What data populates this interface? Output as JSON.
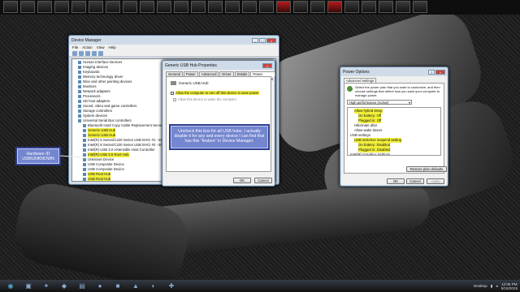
{
  "device_manager": {
    "title": "Device Manager",
    "menu": [
      "File",
      "Action",
      "View",
      "Help"
    ],
    "tree": [
      {
        "label": "Human Interface Devices",
        "hl": false,
        "indent": 1
      },
      {
        "label": "Imaging devices",
        "hl": false,
        "indent": 1
      },
      {
        "label": "Keyboards",
        "hl": false,
        "indent": 1
      },
      {
        "label": "Memory technology driver",
        "hl": false,
        "indent": 1
      },
      {
        "label": "Mice and other pointing devices",
        "hl": false,
        "indent": 1
      },
      {
        "label": "Monitors",
        "hl": false,
        "indent": 1
      },
      {
        "label": "Network adapters",
        "hl": false,
        "indent": 1
      },
      {
        "label": "Processors",
        "hl": false,
        "indent": 1
      },
      {
        "label": "SD host adapters",
        "hl": false,
        "indent": 1
      },
      {
        "label": "Sound, video and game controllers",
        "hl": false,
        "indent": 1
      },
      {
        "label": "Storage controllers",
        "hl": false,
        "indent": 1
      },
      {
        "label": "System devices",
        "hl": false,
        "indent": 1
      },
      {
        "label": "Universal Serial Bus controllers",
        "hl": false,
        "indent": 1
      },
      {
        "label": "Bluetooth Hard Copy Cable Replacement Server",
        "hl": false,
        "indent": 2
      },
      {
        "label": "Generic USB Hub",
        "hl": true,
        "indent": 2
      },
      {
        "label": "Generic USB Hub",
        "hl": true,
        "indent": 2
      },
      {
        "label": "Intel(R) 8 Series/C220 Series USB EHCI #1 - 8C26",
        "hl": false,
        "indent": 2
      },
      {
        "label": "Intel(R) 8 Series/C220 Series USB EHCI #2 - 8C2D",
        "hl": false,
        "indent": 2
      },
      {
        "label": "Intel(R) USB 3.0 eXtensible Host Controller",
        "hl": false,
        "indent": 2
      },
      {
        "label": "Intel(R) USB 3.0 Root Hub",
        "hl": true,
        "indent": 2
      },
      {
        "label": "Unknown Device",
        "hl": false,
        "indent": 2
      },
      {
        "label": "USB Composite Device",
        "hl": false,
        "indent": 2
      },
      {
        "label": "USB Composite Device",
        "hl": false,
        "indent": 2
      },
      {
        "label": "USB Root Hub",
        "hl": true,
        "indent": 2
      },
      {
        "label": "USB Root Hub",
        "hl": true,
        "indent": 2
      }
    ]
  },
  "hub_props": {
    "title": "Generic USB Hub Properties",
    "tabs": [
      "General",
      "Power",
      "Advanced",
      "Driver",
      "Details",
      "Power Management"
    ],
    "device_name": "Generic USB Hub",
    "check1": "Allow the computer to turn off this device to save power",
    "check2": "Allow this device to wake the computer",
    "ok": "OK",
    "cancel": "Cancel"
  },
  "callout_hub": "Uncheck this box for all USB hubs. I actually disable it for any and every device I can find that has this \"feature\" in Device Manager.",
  "callout_hw": {
    "line1": "Hardware ID",
    "line2": "USB\\UNKNOWN"
  },
  "power_options": {
    "title": "Power Options",
    "tab": "Advanced settings",
    "desc": "Select the power plan that you want to customize, and then choose settings that reflect how you want your computer to manage power.",
    "plan": "High performance [Active]",
    "tree": [
      {
        "label": "Allow hybrid sleep",
        "hl": true,
        "indent": 1
      },
      {
        "label": "On battery: Off",
        "hl": true,
        "indent": 2
      },
      {
        "label": "Plugged in: Off",
        "hl": true,
        "indent": 2
      },
      {
        "label": "Hibernate after",
        "hl": false,
        "indent": 1
      },
      {
        "label": "Allow wake timers",
        "hl": false,
        "indent": 1
      },
      {
        "label": "USB settings",
        "hl": false,
        "indent": 0
      },
      {
        "label": "USB selective suspend setting",
        "hl": true,
        "indent": 1
      },
      {
        "label": "On battery: Disabled",
        "hl": true,
        "indent": 2
      },
      {
        "label": "Plugged in: Disabled",
        "hl": true,
        "indent": 2
      },
      {
        "label": "Intel(R) Graphics Settings",
        "hl": false,
        "indent": 0
      }
    ],
    "restore": "Restore plan defaults",
    "ok": "OK",
    "cancel": "Cancel",
    "apply": "Apply"
  },
  "taskbar": {
    "desktop": "Desktop",
    "time": "12:05 PM",
    "date": "5/15/2015"
  },
  "colors": {
    "highlight": "#f1ef3a",
    "callout": "#7386cf"
  }
}
